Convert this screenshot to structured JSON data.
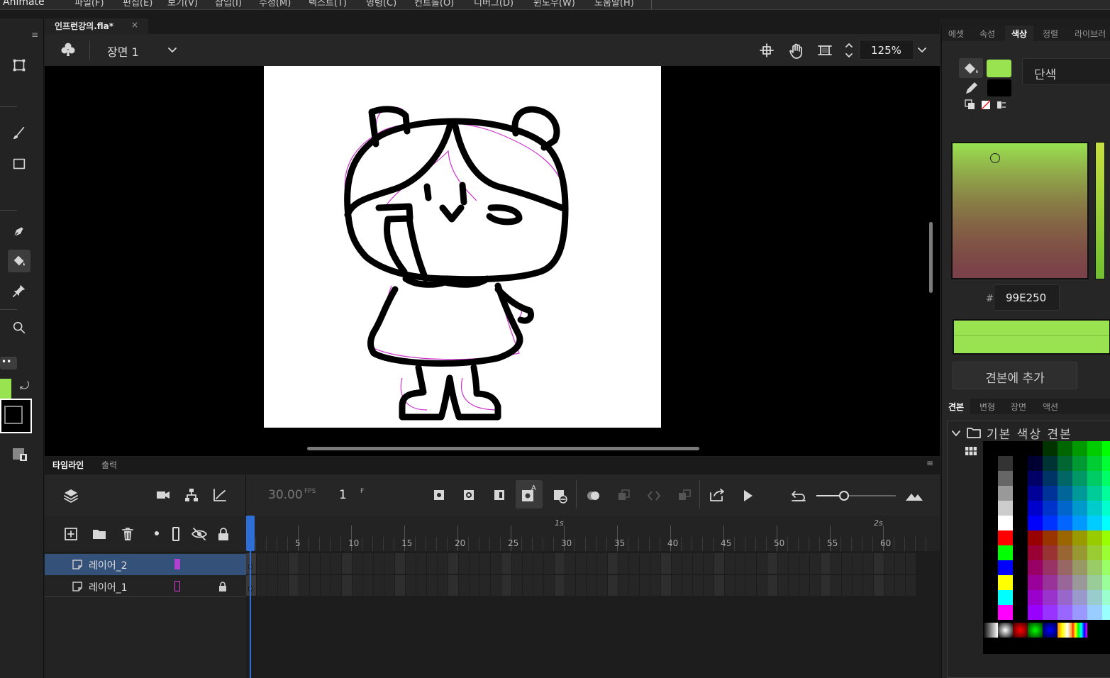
{
  "app": {
    "name": "Animate"
  },
  "menu": {
    "items": [
      "파일(F)",
      "편집(E)",
      "보기(V)",
      "삽입(I)",
      "수정(M)",
      "텍스트(T)",
      "명령(C)",
      "컨트롤(O)",
      "디버그(D)",
      "윈도우(W)",
      "도움말(H)"
    ]
  },
  "document": {
    "tab_title": "인프런강의.fla*",
    "close_glyph": "×"
  },
  "scene": {
    "label": "장면 1",
    "zoom": "125%"
  },
  "timeline": {
    "tabs": [
      "타임라인",
      "출력"
    ],
    "fps": "30.00",
    "fps_unit": "FPS",
    "frame": "1",
    "frame_unit": "F",
    "ruler_seconds": [
      "1s",
      "2s"
    ],
    "ruler_numbers": [
      "5",
      "10",
      "15",
      "20",
      "25",
      "30",
      "35",
      "40",
      "45",
      "50",
      "55",
      "60"
    ],
    "layers": [
      {
        "name": "레이어_2",
        "color": "#b040d0",
        "locked": false,
        "selected": true
      },
      {
        "name": "레이어_1",
        "color": "#d040d0",
        "locked": true,
        "selected": false
      }
    ]
  },
  "right_panel": {
    "top_tabs": [
      "에셋",
      "속성",
      "색상",
      "정렬",
      "라이브러"
    ],
    "active_tab": "색상",
    "fill_color": "#99E250",
    "stroke_color": "#000000",
    "color_type": "단색",
    "hex_prefix": "#",
    "hex_value": "99E250",
    "add_swatch_label": "견본에 추가",
    "bottom_tabs": [
      "견본",
      "변형",
      "장면",
      "액션"
    ],
    "swatch_folder": "기본 색상 견본"
  },
  "colors": {
    "accent": "#2d6fd6",
    "fill": "#99E250",
    "selected_layer_bg": "#34517a"
  },
  "icons": {
    "tools": [
      "transform-icon",
      "brush-icon",
      "rectangle-icon",
      "pen-icon",
      "paint-bucket-icon",
      "pin-icon",
      "zoom-icon"
    ],
    "scene": [
      "club-icon",
      "chevron-down-icon",
      "center-stage-icon",
      "hand-icon",
      "clip-icon"
    ]
  }
}
